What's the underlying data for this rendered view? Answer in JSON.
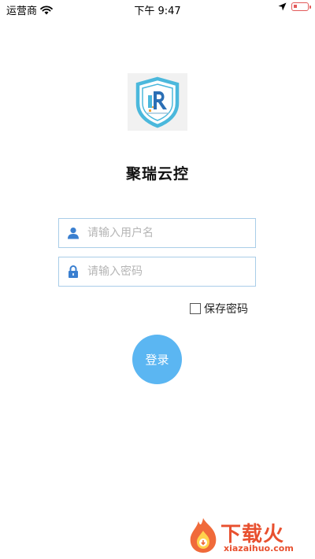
{
  "status_bar": {
    "carrier": "运营商",
    "time": "下午 9:47"
  },
  "app": {
    "title": "聚瑞云控"
  },
  "form": {
    "username_placeholder": "请输入用户名",
    "password_placeholder": "请输入密码",
    "remember_label": "保存密码",
    "remember_checked": false,
    "login_label": "登录"
  },
  "colors": {
    "accent": "#5bb6f2",
    "field_border": "#a9cde8",
    "icon": "#3a7fd0",
    "logo_shield": "#4bb8dc",
    "logo_orange": "#f2a23a"
  },
  "icons": {
    "wifi": "wifi-icon",
    "location": "location-arrow-icon",
    "battery": "battery-low-icon",
    "user": "user-icon",
    "lock": "lock-icon"
  },
  "watermark": {
    "brand": "下载火",
    "url": "xiazaihuo.com"
  }
}
